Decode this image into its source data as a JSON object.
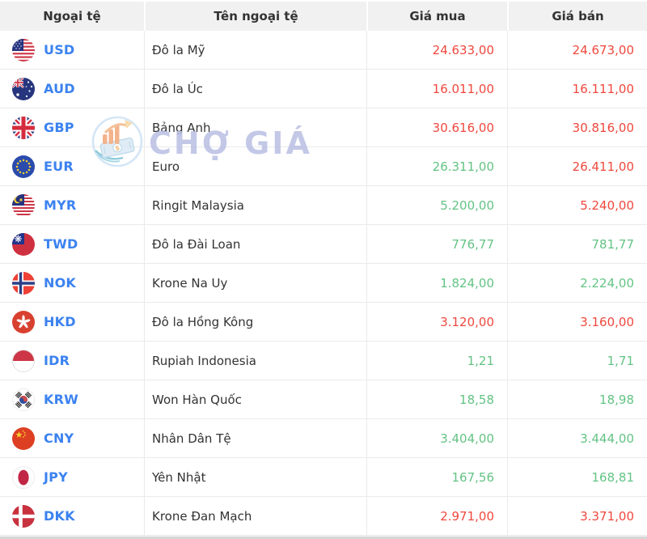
{
  "colors": {
    "up": "#63c384",
    "down": "#ef483e",
    "code": "#3b82f0"
  },
  "watermark": {
    "text": "CHỢ GIÁ"
  },
  "table": {
    "headers": {
      "currency": "Ngoại tệ",
      "name": "Tên ngoại tệ",
      "buy": "Giá mua",
      "sell": "Giá bán"
    },
    "rows": [
      {
        "code": "USD",
        "name": "Đô la Mỹ",
        "buy": "24.633,00",
        "sell": "24.673,00",
        "buy_state": "down",
        "sell_state": "down"
      },
      {
        "code": "AUD",
        "name": "Đô la Úc",
        "buy": "16.011,00",
        "sell": "16.111,00",
        "buy_state": "down",
        "sell_state": "down"
      },
      {
        "code": "GBP",
        "name": "Bảng Anh",
        "buy": "30.616,00",
        "sell": "30.816,00",
        "buy_state": "down",
        "sell_state": "down"
      },
      {
        "code": "EUR",
        "name": "Euro",
        "buy": "26.311,00",
        "sell": "26.411,00",
        "buy_state": "up",
        "sell_state": "down"
      },
      {
        "code": "MYR",
        "name": "Ringit Malaysia",
        "buy": "5.200,00",
        "sell": "5.240,00",
        "buy_state": "up",
        "sell_state": "down"
      },
      {
        "code": "TWD",
        "name": "Đô la Đài Loan",
        "buy": "776,77",
        "sell": "781,77",
        "buy_state": "up",
        "sell_state": "up"
      },
      {
        "code": "NOK",
        "name": "Krone Na Uy",
        "buy": "1.824,00",
        "sell": "2.224,00",
        "buy_state": "up",
        "sell_state": "up"
      },
      {
        "code": "HKD",
        "name": "Đô la Hồng Kông",
        "buy": "3.120,00",
        "sell": "3.160,00",
        "buy_state": "down",
        "sell_state": "down"
      },
      {
        "code": "IDR",
        "name": "Rupiah Indonesia",
        "buy": "1,21",
        "sell": "1,71",
        "buy_state": "up",
        "sell_state": "up"
      },
      {
        "code": "KRW",
        "name": "Won Hàn Quốc",
        "buy": "18,58",
        "sell": "18,98",
        "buy_state": "up",
        "sell_state": "up"
      },
      {
        "code": "CNY",
        "name": "Nhân Dân Tệ",
        "buy": "3.404,00",
        "sell": "3.444,00",
        "buy_state": "up",
        "sell_state": "up"
      },
      {
        "code": "JPY",
        "name": "Yên Nhật",
        "buy": "167,56",
        "sell": "168,81",
        "buy_state": "up",
        "sell_state": "up"
      },
      {
        "code": "DKK",
        "name": "Krone Đan Mạch",
        "buy": "2.971,00",
        "sell": "3.371,00",
        "buy_state": "down",
        "sell_state": "down"
      }
    ]
  }
}
